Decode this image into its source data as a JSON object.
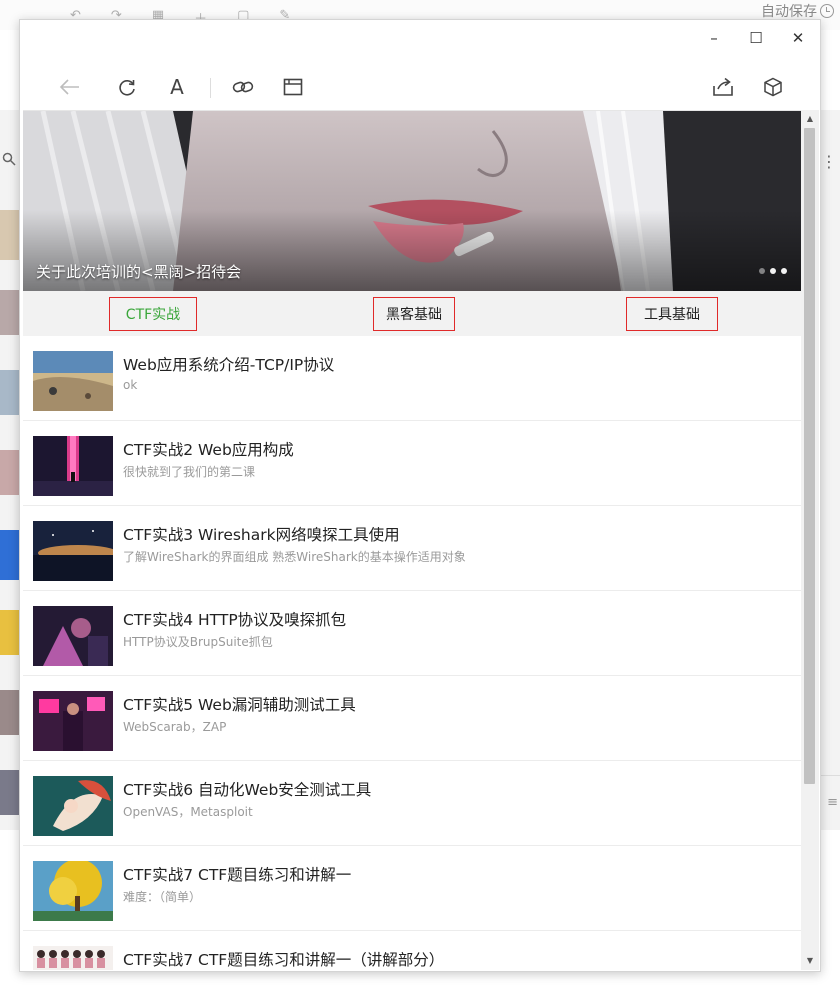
{
  "background_app": {
    "autosave_label": "自动保存"
  },
  "window": {
    "controls": {
      "minimize": "–",
      "maximize": "☐",
      "close": "✕"
    },
    "toolbar": {
      "back_icon": "arrow-left-icon",
      "refresh_icon": "refresh-icon",
      "font_icon": "font-icon",
      "font_glyph": "A",
      "link_icon": "link-icon",
      "browser_icon": "browser-window-icon",
      "share_icon": "share-icon",
      "miniprogram_icon": "cube-icon"
    }
  },
  "banner": {
    "caption": "关于此次培训的<黑阔>招待会",
    "pagination": {
      "total": 3,
      "active": 3
    }
  },
  "tabs": [
    {
      "label": "CTF实战",
      "selected": true
    },
    {
      "label": "黑客基础",
      "selected": false
    },
    {
      "label": "工具基础",
      "selected": false
    }
  ],
  "courses": [
    {
      "title": "Web应用系统介绍-TCP/IP协议",
      "desc": "ok"
    },
    {
      "title": "CTF实战2 Web应用构成",
      "desc": "很快就到了我们的第二课"
    },
    {
      "title": "CTF实战3 Wireshark网络嗅探工具使用",
      "desc": "了解WireShark的界面组成 熟悉WireShark的基本操作适用对象"
    },
    {
      "title": "CTF实战4 HTTP协议及嗅探抓包",
      "desc": "HTTP协议及BrupSuite抓包"
    },
    {
      "title": "CTF实战5 Web漏洞辅助测试工具",
      "desc": "WebScarab，ZAP"
    },
    {
      "title": "CTF实战6 自动化Web安全测试工具",
      "desc": "OpenVAS，Metasploit"
    },
    {
      "title": "CTF实战7 CTF题目练习和讲解一",
      "desc": "难度：（简单）"
    },
    {
      "title": "CTF实战7 CTF题目练习和讲解一（讲解部分）",
      "desc": ""
    }
  ],
  "colors": {
    "selected_tab_text": "#3aa63a",
    "tab_border": "#e02a2a",
    "tab_bar_bg": "#f2f2f2",
    "desc_text": "#9a9a9a"
  }
}
